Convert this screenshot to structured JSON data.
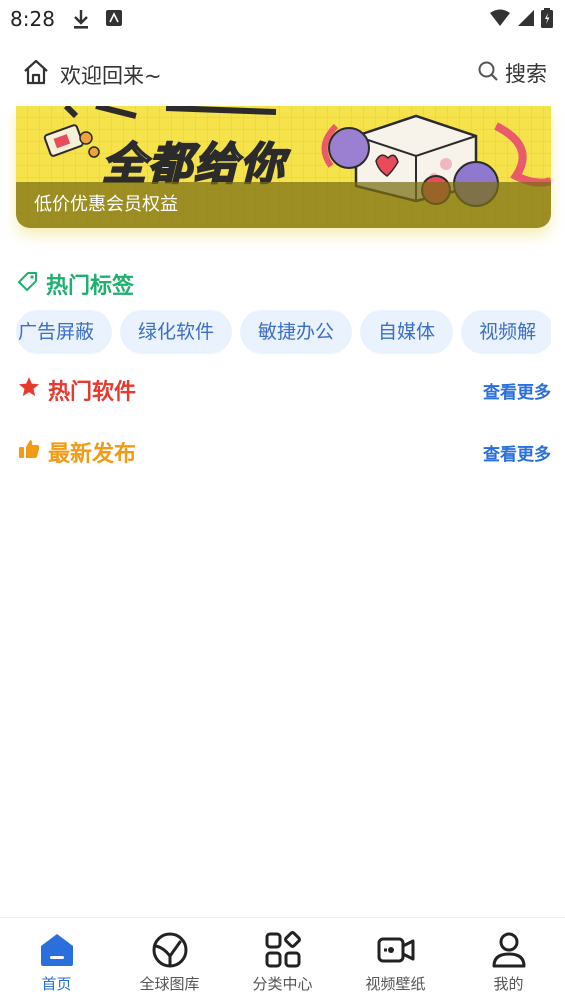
{
  "status_bar": {
    "time": "8:28"
  },
  "header": {
    "title": "欢迎回来~",
    "search_label": "搜索"
  },
  "banner": {
    "headline": "全都给你",
    "caption": "低价优惠会员权益"
  },
  "hot_tags": {
    "title": "热门标签",
    "tags": [
      "广告屏蔽",
      "绿化软件",
      "敏捷办公",
      "自媒体",
      "视频解"
    ]
  },
  "hot_software": {
    "title": "热门软件",
    "more": "查看更多"
  },
  "latest": {
    "title": "最新发布",
    "more": "查看更多"
  },
  "bottom_nav": {
    "items": [
      {
        "label": "首页",
        "icon": "home-icon",
        "active": true
      },
      {
        "label": "全球图库",
        "icon": "globe-gallery-icon",
        "active": false
      },
      {
        "label": "分类中心",
        "icon": "category-icon",
        "active": false
      },
      {
        "label": "视频壁纸",
        "icon": "video-icon",
        "active": false
      },
      {
        "label": "我的",
        "icon": "user-icon",
        "active": false
      }
    ]
  },
  "colors": {
    "accent_blue": "#2a6fdb",
    "tag_green": "#1fb070",
    "hot_red": "#e8392f",
    "new_orange": "#f39b12",
    "banner_yellow": "#f5e04a"
  }
}
